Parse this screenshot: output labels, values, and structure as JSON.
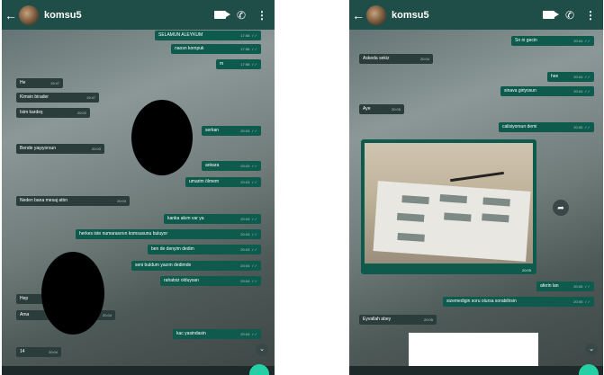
{
  "left": {
    "contact_name": "komsu5",
    "messages": [
      {
        "text": "SELAMUN ALEYKUM",
        "time": "17:58",
        "dir": "out"
      },
      {
        "text": "naosn kompuk",
        "time": "17:58",
        "dir": "out"
      },
      {
        "text": "m",
        "time": "17:58",
        "dir": "out"
      },
      {
        "text": "He",
        "time": "19:47",
        "dir": "in"
      },
      {
        "text": "Kimsin birader",
        "time": "19:47",
        "dir": "in"
      },
      {
        "text": "Isim kardeş",
        "time": "20:02",
        "dir": "in"
      },
      {
        "text": "serkan",
        "time": "20:03",
        "dir": "out"
      },
      {
        "text": "Bende yaşıyorsun",
        "time": "20:03",
        "dir": "in"
      },
      {
        "text": "ankara",
        "time": "20:03",
        "dir": "out"
      },
      {
        "text": "umarim ölmem",
        "time": "20:03",
        "dir": "out"
      },
      {
        "text": "Neden bana mesaj attın",
        "time": "20:03",
        "dir": "in"
      },
      {
        "text": "kanka akım var ya",
        "time": "20:03",
        "dir": "out"
      },
      {
        "text": "herkes iste numarasının komsusunu buluyor",
        "time": "20:03",
        "dir": "out"
      },
      {
        "text": "ben de denyim dedim",
        "time": "20:03",
        "dir": "out"
      },
      {
        "text": "seni buldum yazım dedimde",
        "time": "20:04",
        "dir": "out"
      },
      {
        "text": "rahatsiz olduysan",
        "time": "20:04",
        "dir": "out"
      },
      {
        "text": "Hep",
        "time": "",
        "dir": "in"
      },
      {
        "text": "Ama",
        "time": "20:04",
        "dir": "in"
      },
      {
        "text": "kac yasindasin",
        "time": "20:04",
        "dir": "out"
      },
      {
        "text": "14",
        "time": "20:04",
        "dir": "in"
      }
    ]
  },
  "right": {
    "contact_name": "komsu5",
    "messages": [
      {
        "text": "Sn ni gecin",
        "time": "20:04",
        "dir": "out"
      },
      {
        "text": "Askeda sekiz",
        "time": "20:04",
        "dir": "in"
      },
      {
        "text": "hee",
        "time": "20:04",
        "dir": "out"
      },
      {
        "text": "sinava giriyosun",
        "time": "20:04",
        "dir": "out"
      },
      {
        "text": "Aye",
        "time": "20:05",
        "dir": "in"
      },
      {
        "text": "calisiyorsun demi",
        "time": "20:05",
        "dir": "out"
      },
      {
        "text": "",
        "time": "20:05",
        "dir": "in",
        "photo": true
      },
      {
        "text": "aferin lan",
        "time": "20:05",
        "dir": "out"
      },
      {
        "text": "sizemedigin soru olursa sorabilirsin",
        "time": "20:05",
        "dir": "out"
      },
      {
        "text": "Eyvallah abey",
        "time": "20:05",
        "dir": "in"
      }
    ]
  },
  "icons": {
    "back": "back-arrow-icon",
    "video": "video-call-icon",
    "call": "phone-call-icon",
    "menu": "more-options-icon",
    "share": "share-icon",
    "scroll": "scroll-down-icon"
  },
  "colors": {
    "header": "#1f4d47",
    "outgoing_bubble": "#0e5a4c",
    "incoming_bubble": "#2b3d3b",
    "read_ticks": "#7fd6f0",
    "fab": "#25d0a4"
  }
}
